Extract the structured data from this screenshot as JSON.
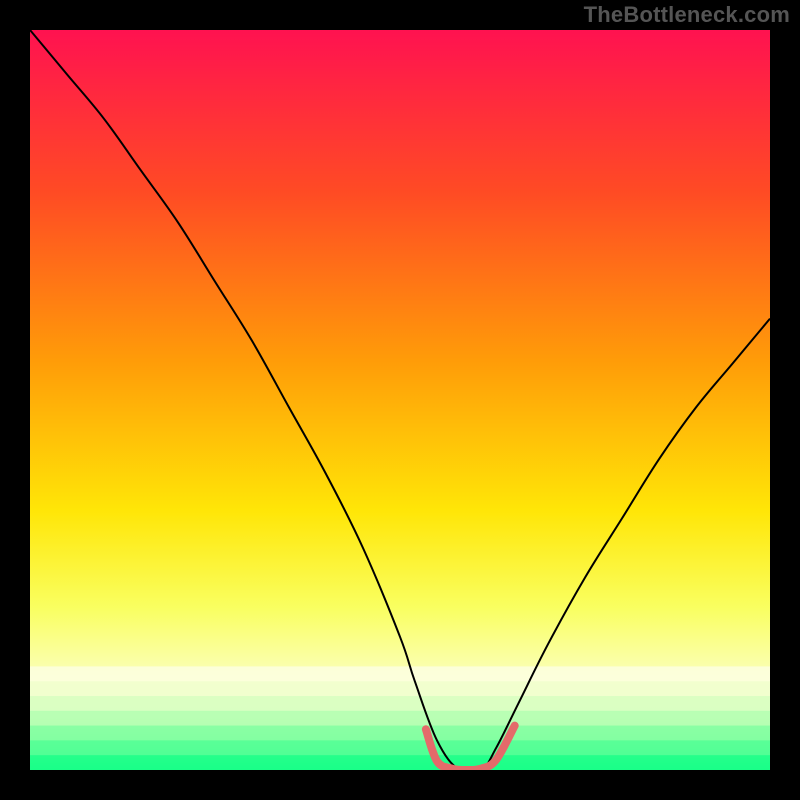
{
  "watermark": "TheBottleneck.com",
  "chart_data": {
    "type": "line",
    "title": "",
    "xlabel": "",
    "ylabel": "",
    "xlim": [
      0,
      100
    ],
    "ylim": [
      0,
      100
    ],
    "grid": false,
    "legend": false,
    "background": {
      "type": "vertical-gradient",
      "stops": [
        {
          "pos": 0.0,
          "color": "#ff1250"
        },
        {
          "pos": 0.22,
          "color": "#ff4b24"
        },
        {
          "pos": 0.45,
          "color": "#ff9d08"
        },
        {
          "pos": 0.65,
          "color": "#ffe607"
        },
        {
          "pos": 0.78,
          "color": "#f9ff60"
        },
        {
          "pos": 0.88,
          "color": "#fbffbf"
        },
        {
          "pos": 0.93,
          "color": "#e7ffc6"
        },
        {
          "pos": 0.97,
          "color": "#8effa0"
        },
        {
          "pos": 1.0,
          "color": "#1aff88"
        }
      ]
    },
    "series": [
      {
        "name": "bottleneck-curve",
        "color": "#000000",
        "stroke_width": 2,
        "x": [
          0,
          5,
          10,
          15,
          20,
          25,
          30,
          35,
          40,
          45,
          50,
          52,
          55,
          58,
          61,
          63,
          66,
          70,
          75,
          80,
          85,
          90,
          95,
          100
        ],
        "y": [
          100,
          94,
          88,
          81,
          74,
          66,
          58,
          49,
          40,
          30,
          18,
          12,
          4,
          0,
          0,
          3,
          9,
          17,
          26,
          34,
          42,
          49,
          55,
          61
        ]
      },
      {
        "name": "optimal-flat",
        "color": "#e46a6a",
        "stroke_width": 8,
        "linecap": "round",
        "x": [
          53.5,
          55,
          57,
          59,
          61,
          63,
          65.5
        ],
        "y": [
          5.5,
          1.2,
          0.2,
          0.0,
          0.2,
          1.4,
          6.0
        ]
      }
    ]
  }
}
